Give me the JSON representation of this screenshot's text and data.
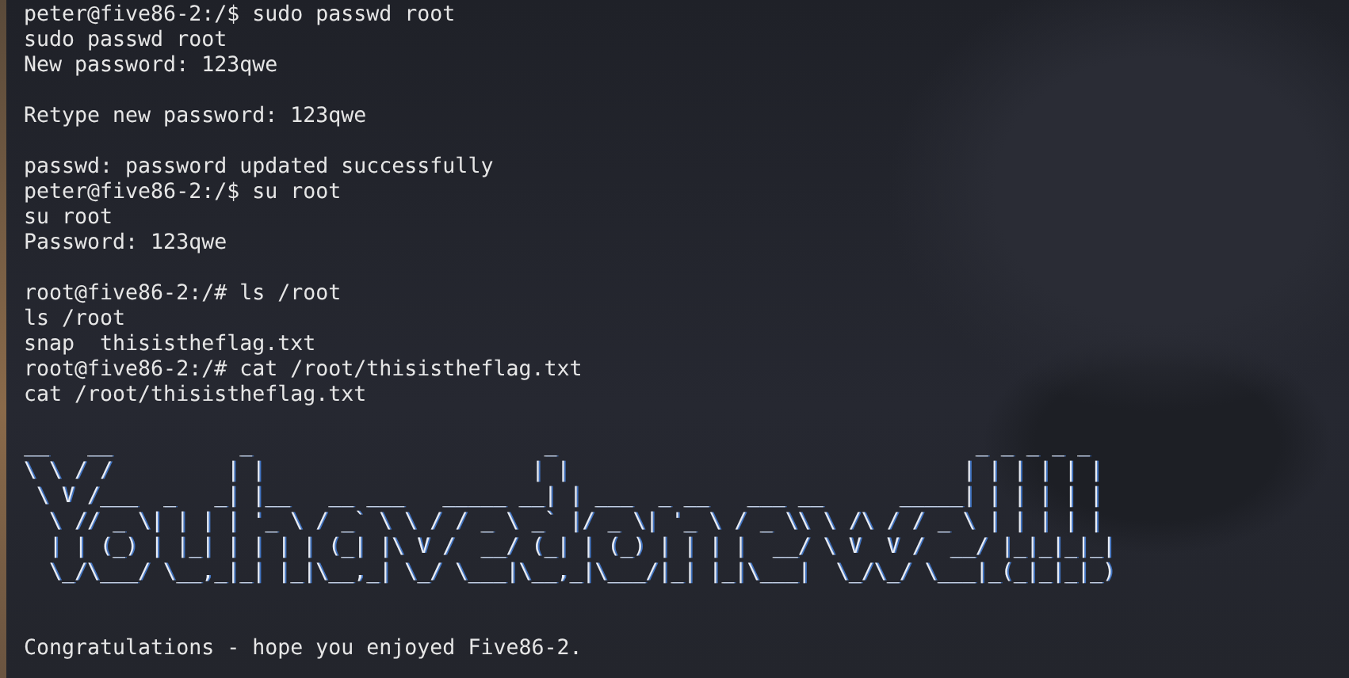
{
  "terminal": {
    "lines": [
      {
        "kind": "prompt",
        "text": "peter@five86-2:/$ sudo passwd root"
      },
      {
        "kind": "output",
        "text": "sudo passwd root"
      },
      {
        "kind": "output",
        "text": "New password: 123qwe"
      },
      {
        "kind": "blank"
      },
      {
        "kind": "output",
        "text": "Retype new password: 123qwe"
      },
      {
        "kind": "blank"
      },
      {
        "kind": "output",
        "text": "passwd: password updated successfully"
      },
      {
        "kind": "prompt",
        "text": "peter@five86-2:/$ su root"
      },
      {
        "kind": "output",
        "text": "su root"
      },
      {
        "kind": "output",
        "text": "Password: 123qwe"
      },
      {
        "kind": "blank"
      },
      {
        "kind": "prompt",
        "text": "root@five86-2:/# ls /root"
      },
      {
        "kind": "output",
        "text": "ls /root"
      },
      {
        "kind": "output",
        "text": "snap  thisistheflag.txt"
      },
      {
        "kind": "prompt",
        "text": "root@five86-2:/# cat /root/thisistheflag.txt"
      },
      {
        "kind": "output",
        "text": "cat /root/thisistheflag.txt"
      },
      {
        "kind": "blank"
      },
      {
        "kind": "art",
        "text": "__   __          _                       _                                 _ _ _ _ _ "
      },
      {
        "kind": "art",
        "text": "\\ \\ / /         | |                     | |                               | | | | | |"
      },
      {
        "kind": "art",
        "text": " \\ V /___  _   _| |__   __ ___   _____ __| | ___  _ __   ___ __      _____| | | | | |"
      },
      {
        "kind": "art",
        "text": "  \\ // _ \\| | | | '_ \\ / _` \\ \\ / / _ \\ _` |/ _ \\| '_ \\ / _ \\\\ \\ /\\ / / _ \\ | | | | |"
      },
      {
        "kind": "art",
        "text": "  | | (_) | |_| | | | | (_| |\\ V /  __/ (_| | (_) | | | |  __/ \\ V  V /  __/ |_|_|_|_|"
      },
      {
        "kind": "art",
        "text": "  \\_/\\___/ \\__,_|_| |_|\\__,_| \\_/ \\___|\\__,_|\\___/|_| |_|\\___|  \\_/\\_/ \\___|_(_|_|_|_)"
      },
      {
        "kind": "blank"
      },
      {
        "kind": "blank"
      },
      {
        "kind": "output",
        "text": "Congratulations - hope you enjoyed Five86-2."
      }
    ]
  }
}
